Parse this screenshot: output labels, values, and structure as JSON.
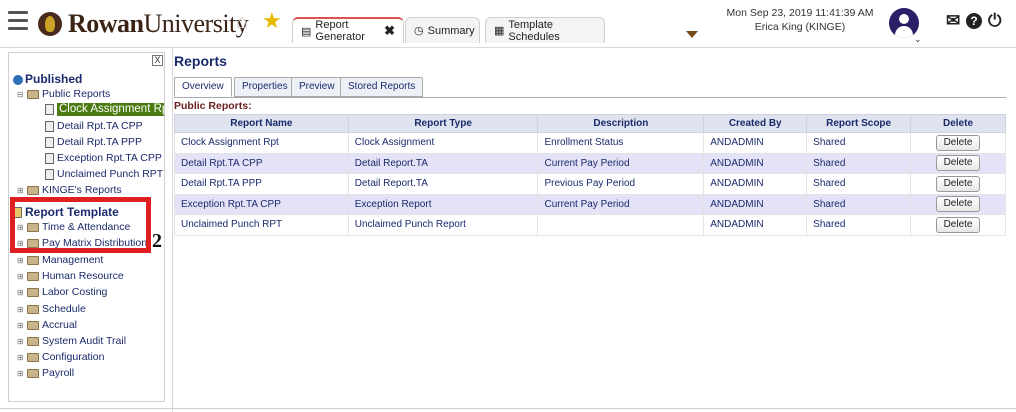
{
  "header": {
    "brand_bold": "Rowan",
    "brand_light": "University",
    "tabs": [
      {
        "label": "Report Generator",
        "icon": "report-icon",
        "active": true,
        "closable": true
      },
      {
        "label": "Summary",
        "icon": "clock-icon",
        "active": false
      },
      {
        "label": "Template Schedules",
        "icon": "calendar-icon",
        "active": false
      }
    ],
    "datetime": "Mon Sep 23, 2019 11:41:39 AM",
    "user": "Erica King (KINGE)",
    "icons": {
      "mail": "✉",
      "help": "?",
      "power": "⏻"
    }
  },
  "sidebar": {
    "published_label": "Published",
    "public_reports_label": "Public Reports",
    "public_reports": [
      "Clock Assignment Rpt",
      "Detail Rpt.TA CPP",
      "Detail Rpt.TA PPP",
      "Exception Rpt.TA CPP",
      "Unclaimed Punch RPT"
    ],
    "user_reports_label": "KINGE's Reports",
    "report_template_label": "Report Template",
    "templates": [
      "Time & Attendance",
      "Pay Matrix Distribution",
      "Management",
      "Human Resource",
      "Labor Costing",
      "Schedule",
      "Accrual",
      "System Audit Trail",
      "Configuration",
      "Payroll"
    ],
    "close_symbol": "X"
  },
  "annotation": {
    "marker": "2",
    "color": "#e02020"
  },
  "main": {
    "title": "Reports",
    "subtabs": [
      "Overview",
      "Properties",
      "Preview",
      "Stored Reports"
    ],
    "section_label": "Public Reports:",
    "columns": [
      "Report Name",
      "Report Type",
      "Description",
      "Created By",
      "Report Scope",
      "Delete"
    ],
    "rows": [
      {
        "name": "Clock Assignment Rpt",
        "type": "Clock Assignment",
        "description": "Enrollment Status",
        "created_by": "ANDADMIN",
        "scope": "Shared",
        "delete": "Delete"
      },
      {
        "name": "Detail Rpt.TA CPP",
        "type": "Detail Report.TA",
        "description": "Current Pay Period",
        "created_by": "ANDADMIN",
        "scope": "Shared",
        "delete": "Delete"
      },
      {
        "name": "Detail Rpt.TA PPP",
        "type": "Detail Report.TA",
        "description": "Previous Pay Period",
        "created_by": "ANDADMIN",
        "scope": "Shared",
        "delete": "Delete"
      },
      {
        "name": "Exception Rpt.TA CPP",
        "type": "Exception Report",
        "description": "Current Pay Period",
        "created_by": "ANDADMIN",
        "scope": "Shared",
        "delete": "Delete"
      },
      {
        "name": "Unclaimed Punch RPT",
        "type": "Unclaimed Punch Report",
        "description": "",
        "created_by": "ANDADMIN",
        "scope": "Shared",
        "delete": "Delete"
      }
    ]
  },
  "colors": {
    "brand": "#3b2416",
    "accent_gold": "#e6b800",
    "selected": "#4a7a10",
    "alt_row": "#e4e2f7",
    "header_row": "#dfe3ef",
    "link_text": "#1a2a6b"
  }
}
